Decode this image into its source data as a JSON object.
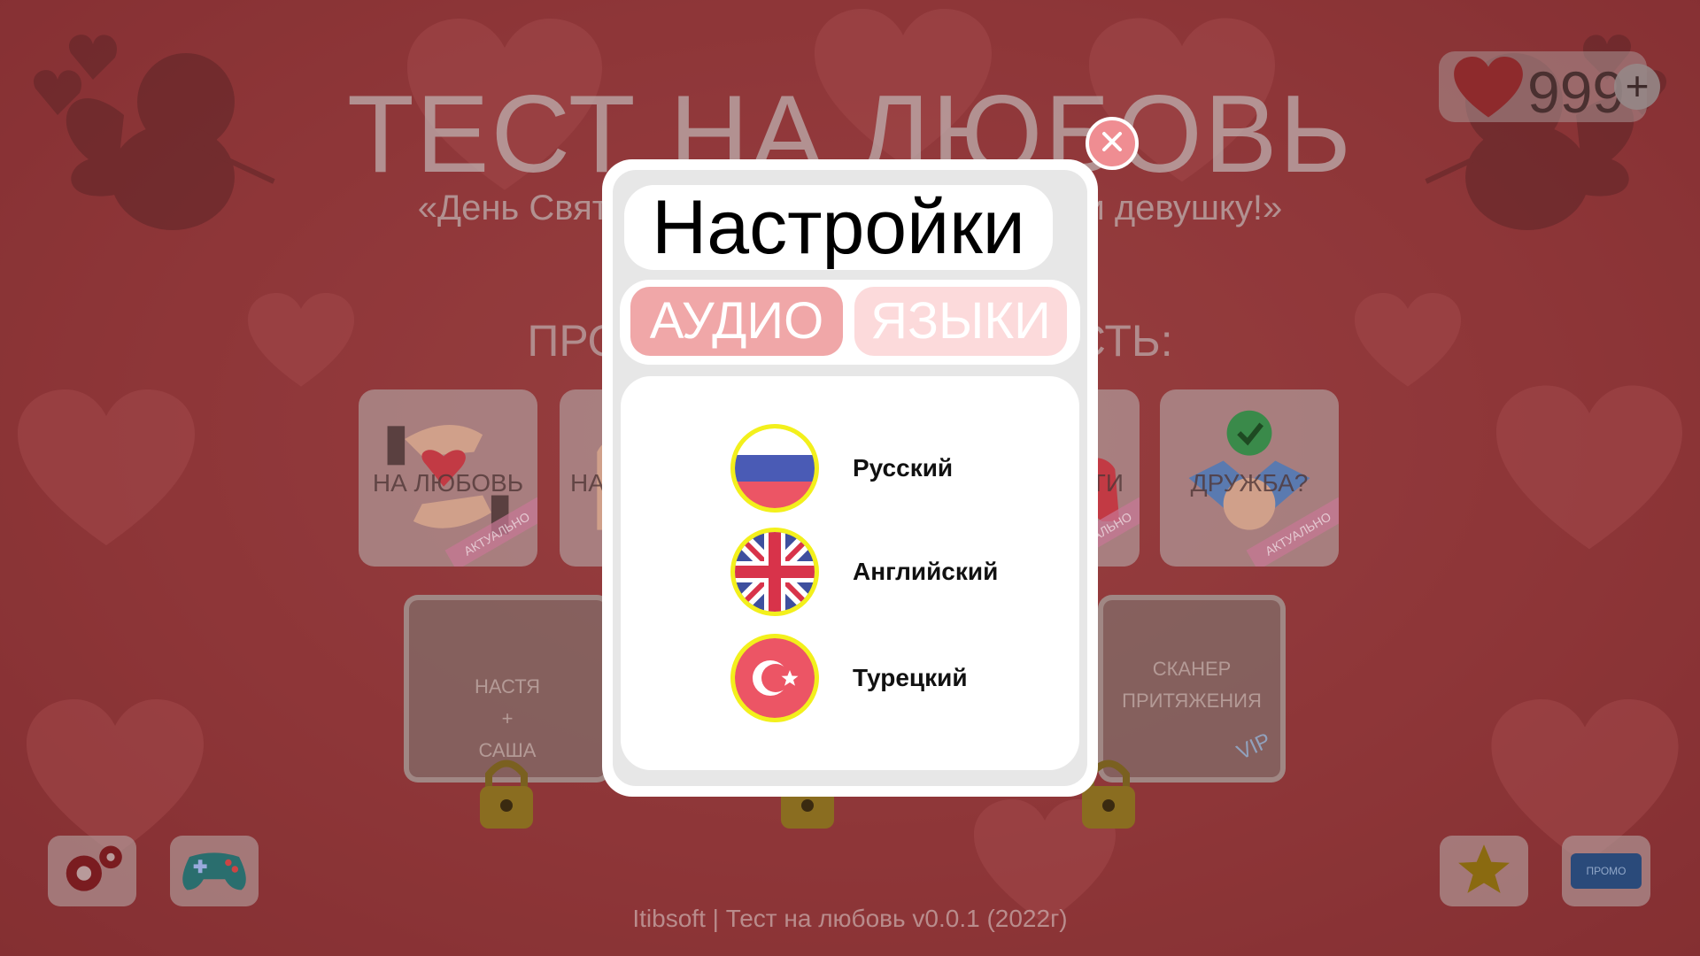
{
  "header": {
    "title": "ТЕСТ НА ЛЮБОВЬ",
    "subtitle": "«День Святого Валентина, чтобы завести девушку!»",
    "check_label": "ПРОВЕРЬ СОВМЕСТИМОСТЬ:"
  },
  "hearts_counter": {
    "value": "999",
    "plus_label": "+",
    "icon": "heart-icon"
  },
  "categories": [
    {
      "label": "НА ЛЮБОВЬ",
      "ribbon": "АКТУАЛЬНО",
      "icon": "heart-hands-icon"
    },
    {
      "label": "НА",
      "icon": "hand-icon"
    },
    {
      "label": "ТИ",
      "ribbon": "АКТУАЛЬНО",
      "icon": "heart-icon"
    },
    {
      "label": "ДРУЖБА?",
      "ribbon": "АКТУАЛЬНО",
      "icon": "handshake-icon"
    }
  ],
  "banners": [
    {
      "label_line1": "НАСТЯ",
      "label_line2": "+",
      "label_line3": "САША"
    },
    {
      "label_line1": "СКАНЕР",
      "label_line2": "ПРИТЯЖЕНИЯ",
      "badge": "VIP"
    }
  ],
  "bottom_bar": {
    "settings_icon": "gears-icon",
    "games_icon": "gamepad-icon",
    "rate_icon": "star-icon",
    "promo_label": "ПРОМО"
  },
  "footer": "Itibsoft | Тест на любовь v0.0.1 (2022г)",
  "settings_dialog": {
    "title": "Настройки",
    "tabs": [
      {
        "label": "АУДИО",
        "active": false
      },
      {
        "label": "ЯЗЫКИ",
        "active": true
      }
    ],
    "languages": [
      {
        "name": "Русский",
        "flag": "russia-flag-icon"
      },
      {
        "name": "Английский",
        "flag": "uk-flag-icon"
      },
      {
        "name": "Турецкий",
        "flag": "turkey-flag-icon"
      }
    ],
    "close_icon": "close-icon"
  },
  "colors": {
    "background": "#c04a4d",
    "tab_active": "#f0a7a8",
    "tab_inactive": "#fcdadb",
    "close_button": "#ef8d92",
    "flag_ring": "#f3f01c"
  }
}
